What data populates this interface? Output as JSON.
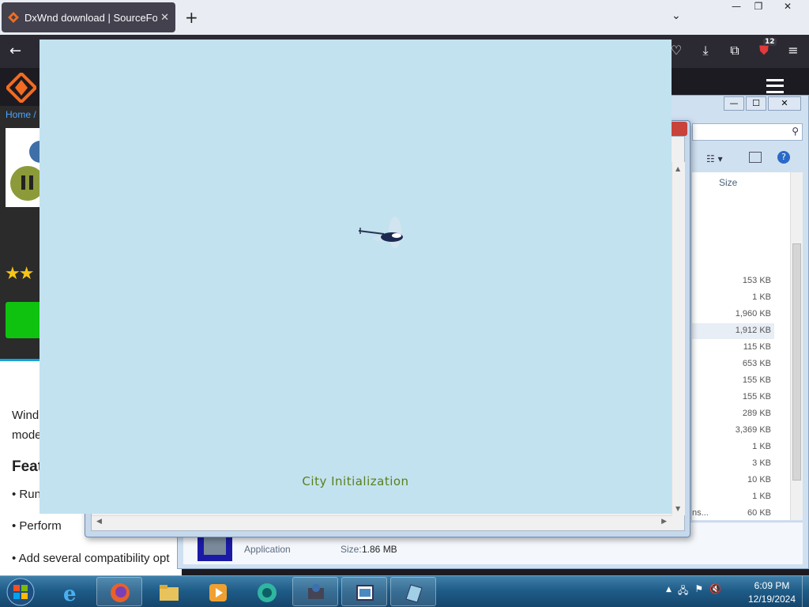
{
  "browser": {
    "tab_title": "DxWnd download | SourceForge",
    "tab_close": "✕",
    "new_tab": "+",
    "tab_list": "⌄",
    "window_controls": {
      "minimize": "—",
      "restore": "❐",
      "close": "✕"
    },
    "back": "←",
    "extension_badge": "12"
  },
  "sourceforge": {
    "breadcrumb": "Home /",
    "body_lines": [
      "Wind",
      "mode",
      "Feat",
      "• Run",
      "• Perform",
      "• Add several compatibility opt"
    ]
  },
  "explorer": {
    "controls": {
      "minimize": "—",
      "maximize": "☐",
      "close": "✕"
    },
    "column_size": "Size",
    "sizes": [
      "153 KB",
      "1 KB",
      "1,960 KB",
      "1,912 KB",
      "115 KB",
      "653 KB",
      "155 KB",
      "155 KB",
      "289 KB",
      "3,369 KB",
      "1 KB",
      "3 KB",
      "10 KB",
      "1 KB",
      "60 KB"
    ],
    "truncated_name": "ns...",
    "detail": {
      "type": "Application",
      "size_label": "Size:",
      "size_value": "1.86 MB"
    }
  },
  "game": {
    "status_text": "City Initialization"
  },
  "taskbar": {
    "time": "6:09 PM",
    "date": "12/19/2024",
    "tray_arrow": "▲"
  }
}
